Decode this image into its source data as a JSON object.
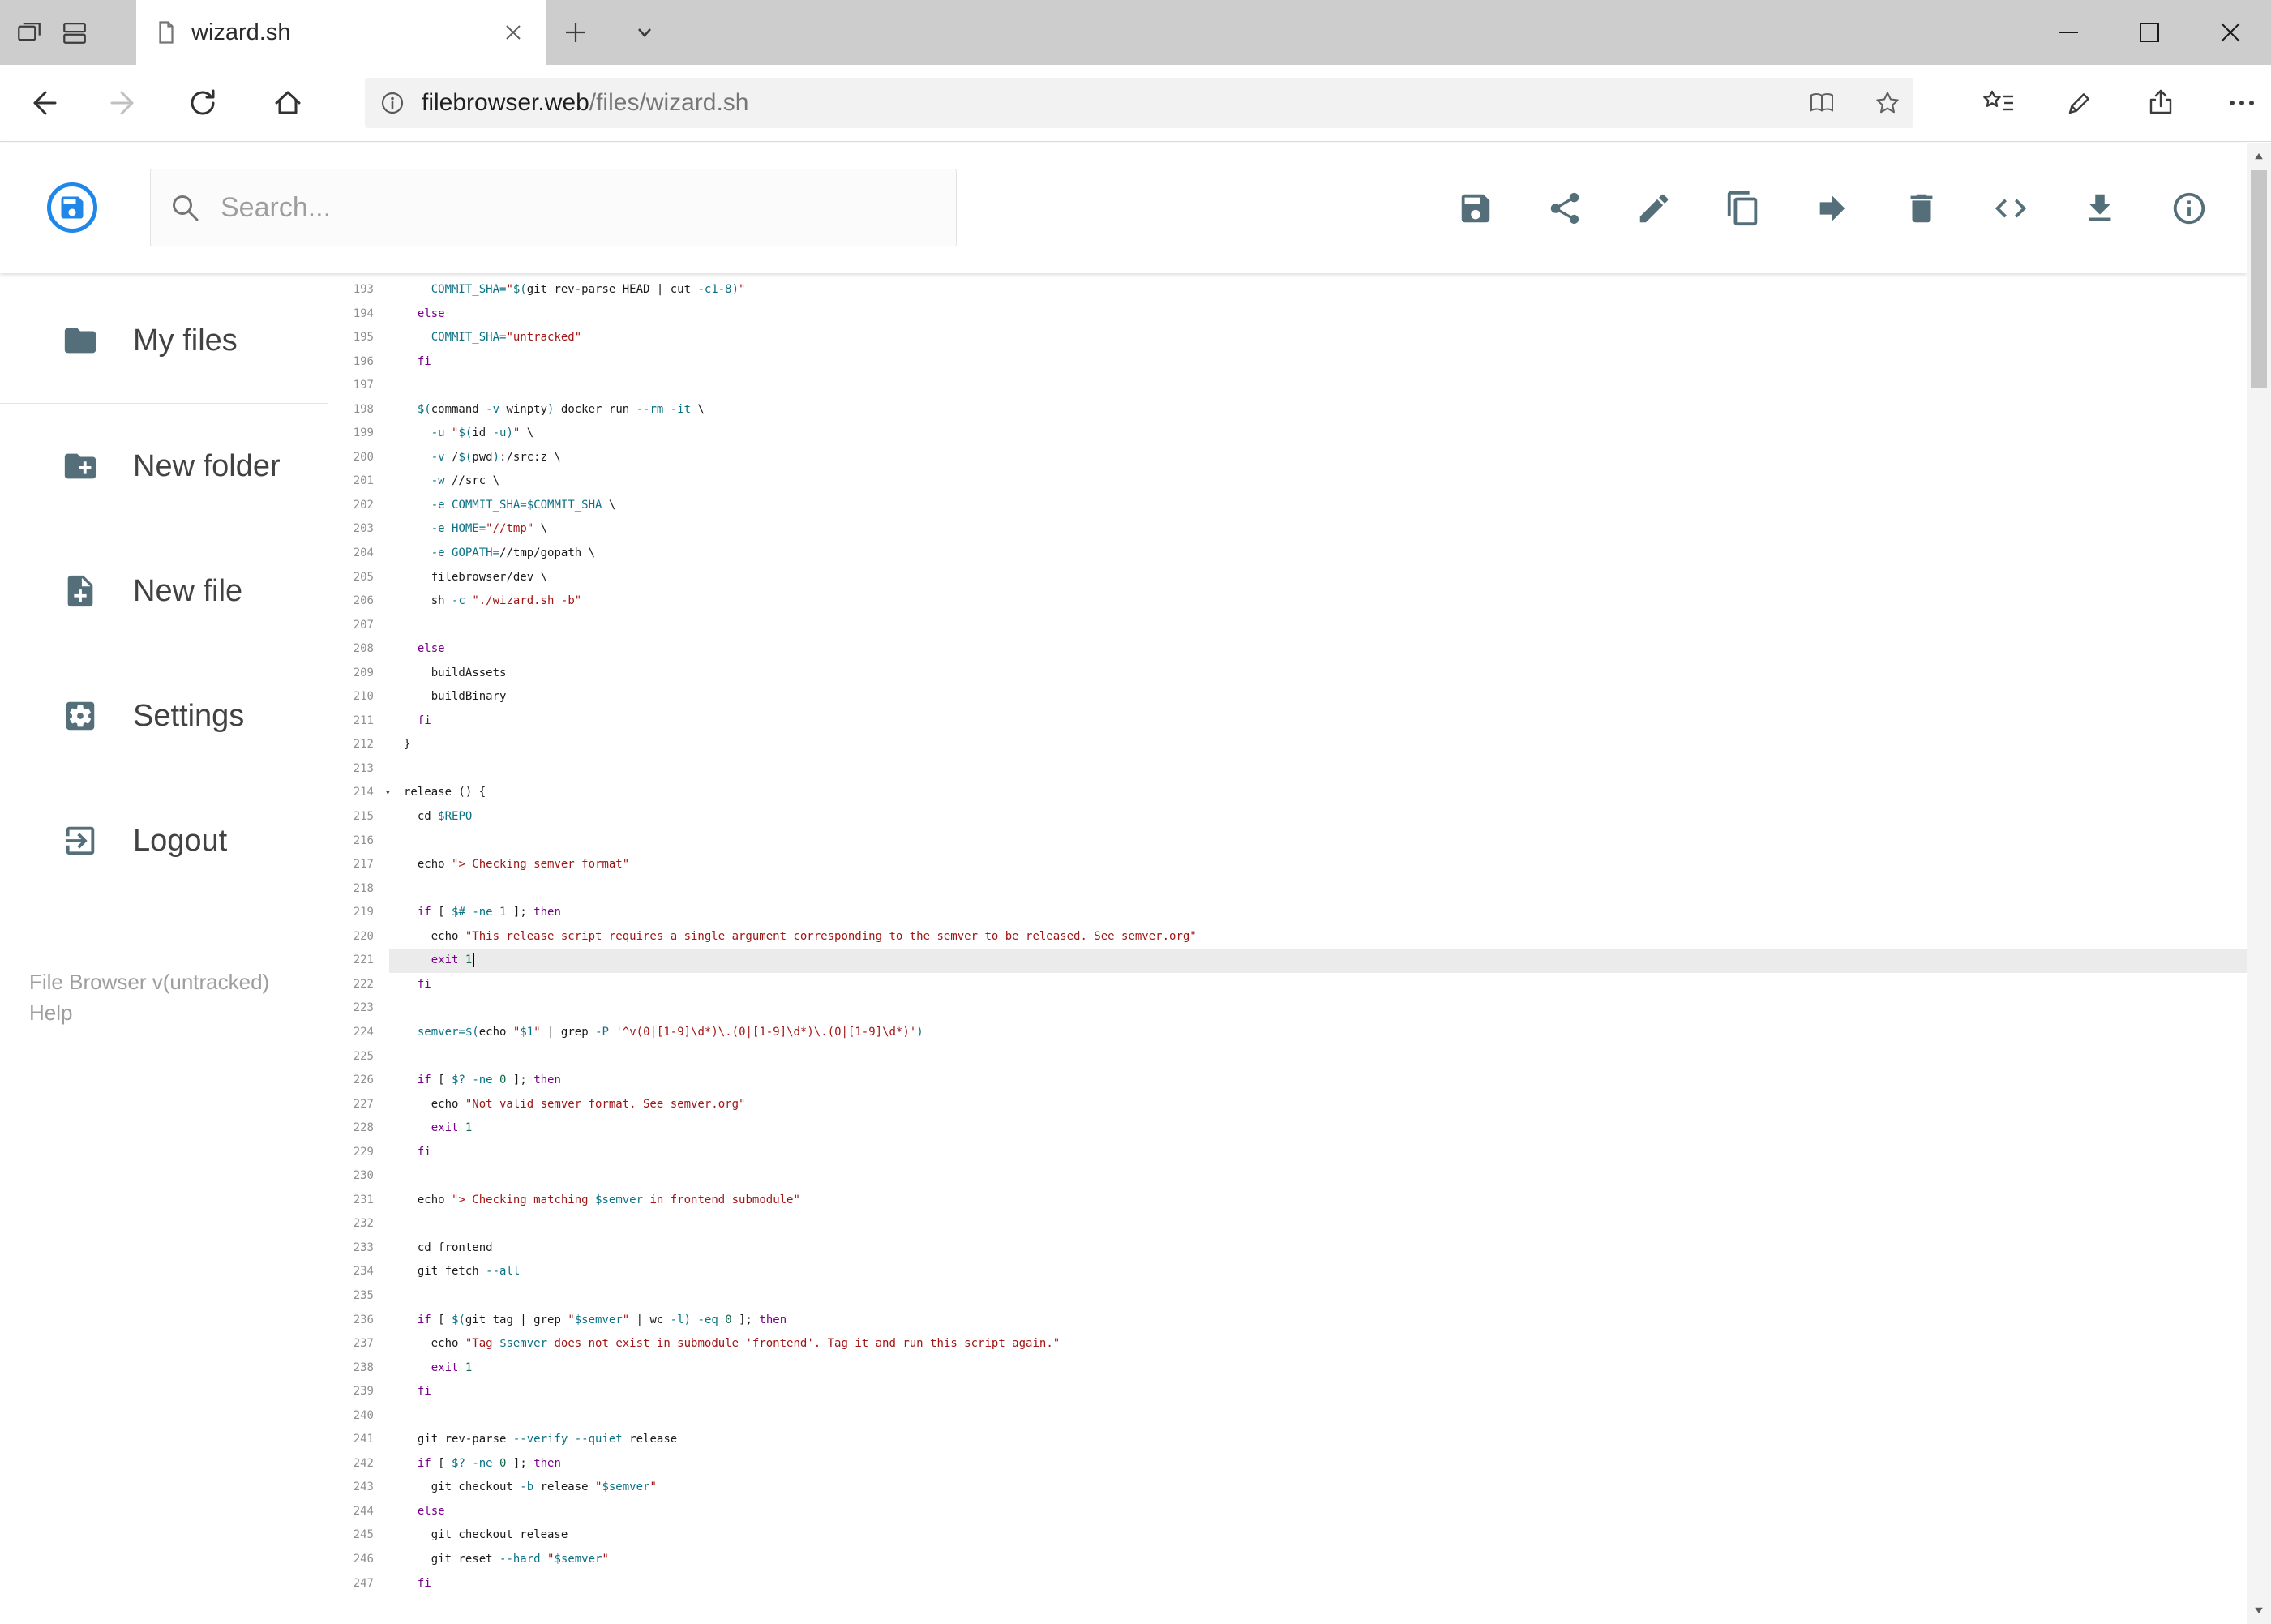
{
  "browser": {
    "tab_title": "wizard.sh",
    "url_domain": "filebrowser.web",
    "url_path": "/files/wizard.sh"
  },
  "header": {
    "search_placeholder": "Search...",
    "toolbar_icons": [
      "save-icon",
      "share-icon",
      "edit-icon",
      "copy-icon",
      "move-icon",
      "delete-icon",
      "code-icon",
      "download-icon",
      "info-icon"
    ],
    "logo_color": "#1f87e8"
  },
  "sidebar": {
    "items": [
      {
        "icon": "folder-icon",
        "label": "My files",
        "divider_after": true
      },
      {
        "icon": "new-folder-icon",
        "label": "New folder"
      },
      {
        "icon": "new-file-icon",
        "label": "New file"
      },
      {
        "icon": "settings-icon",
        "label": "Settings"
      },
      {
        "icon": "logout-icon",
        "label": "Logout"
      }
    ],
    "footer_version": "File Browser v(untracked)",
    "footer_help": "Help"
  },
  "editor": {
    "active_line": 221,
    "fold_line": 214,
    "colors": {
      "p": "#1b1b1b",
      "k": "#770088",
      "s": "#a31515",
      "v": "#0b7285",
      "n": "#116644",
      "gutter": "#8f8f8f",
      "active_bg": "#ebebeb"
    },
    "lines": [
      {
        "n": 193,
        "t": [
          [
            "p",
            "    "
          ],
          [
            "v",
            "COMMIT_SHA="
          ],
          [
            "s",
            "\""
          ],
          [
            "v",
            "$("
          ],
          [
            "p",
            "git rev-parse HEAD | cut "
          ],
          [
            "v",
            "-c1-8"
          ],
          [
            "v",
            ")"
          ],
          [
            "s",
            "\""
          ]
        ]
      },
      {
        "n": 194,
        "t": [
          [
            "p",
            "  "
          ],
          [
            "k",
            "else"
          ]
        ]
      },
      {
        "n": 195,
        "t": [
          [
            "p",
            "    "
          ],
          [
            "v",
            "COMMIT_SHA="
          ],
          [
            "s",
            "\"untracked\""
          ]
        ]
      },
      {
        "n": 196,
        "t": [
          [
            "p",
            "  "
          ],
          [
            "k",
            "fi"
          ]
        ]
      },
      {
        "n": 197,
        "t": []
      },
      {
        "n": 198,
        "t": [
          [
            "p",
            "  "
          ],
          [
            "v",
            "$("
          ],
          [
            "p",
            "command "
          ],
          [
            "v",
            "-v"
          ],
          [
            "p",
            " winpty"
          ],
          [
            "v",
            ")"
          ],
          [
            "p",
            " docker run "
          ],
          [
            "v",
            "--rm"
          ],
          [
            "p",
            " "
          ],
          [
            "v",
            "-it"
          ],
          [
            "p",
            " \\"
          ]
        ]
      },
      {
        "n": 199,
        "t": [
          [
            "p",
            "    "
          ],
          [
            "v",
            "-u"
          ],
          [
            "p",
            " "
          ],
          [
            "s",
            "\""
          ],
          [
            "v",
            "$("
          ],
          [
            "p",
            "id "
          ],
          [
            "v",
            "-u"
          ],
          [
            "v",
            ")"
          ],
          [
            "s",
            "\""
          ],
          [
            "p",
            " \\"
          ]
        ]
      },
      {
        "n": 200,
        "t": [
          [
            "p",
            "    "
          ],
          [
            "v",
            "-v"
          ],
          [
            "p",
            " /"
          ],
          [
            "v",
            "$("
          ],
          [
            "p",
            "pwd"
          ],
          [
            "v",
            ")"
          ],
          [
            "p",
            ":/src:z \\"
          ]
        ]
      },
      {
        "n": 201,
        "t": [
          [
            "p",
            "    "
          ],
          [
            "v",
            "-w"
          ],
          [
            "p",
            " //src \\"
          ]
        ]
      },
      {
        "n": 202,
        "t": [
          [
            "p",
            "    "
          ],
          [
            "v",
            "-e"
          ],
          [
            "p",
            " "
          ],
          [
            "v",
            "COMMIT_SHA="
          ],
          [
            "v",
            "$COMMIT_SHA"
          ],
          [
            "p",
            " \\"
          ]
        ]
      },
      {
        "n": 203,
        "t": [
          [
            "p",
            "    "
          ],
          [
            "v",
            "-e"
          ],
          [
            "p",
            " "
          ],
          [
            "v",
            "HOME="
          ],
          [
            "s",
            "\"//tmp\""
          ],
          [
            "p",
            " \\"
          ]
        ]
      },
      {
        "n": 204,
        "t": [
          [
            "p",
            "    "
          ],
          [
            "v",
            "-e"
          ],
          [
            "p",
            " "
          ],
          [
            "v",
            "GOPATH="
          ],
          [
            "p",
            "//tmp/gopath \\"
          ]
        ]
      },
      {
        "n": 205,
        "t": [
          [
            "p",
            "    filebrowser/dev \\"
          ]
        ]
      },
      {
        "n": 206,
        "t": [
          [
            "p",
            "    sh "
          ],
          [
            "v",
            "-c"
          ],
          [
            "p",
            " "
          ],
          [
            "s",
            "\"./wizard.sh -b\""
          ]
        ]
      },
      {
        "n": 207,
        "t": []
      },
      {
        "n": 208,
        "t": [
          [
            "p",
            "  "
          ],
          [
            "k",
            "else"
          ]
        ]
      },
      {
        "n": 209,
        "t": [
          [
            "p",
            "    buildAssets"
          ]
        ]
      },
      {
        "n": 210,
        "t": [
          [
            "p",
            "    buildBinary"
          ]
        ]
      },
      {
        "n": 211,
        "t": [
          [
            "p",
            "  "
          ],
          [
            "k",
            "fi"
          ]
        ]
      },
      {
        "n": 212,
        "t": [
          [
            "p",
            "}"
          ]
        ]
      },
      {
        "n": 213,
        "t": []
      },
      {
        "n": 214,
        "t": [
          [
            "p",
            "release () {"
          ]
        ]
      },
      {
        "n": 215,
        "t": [
          [
            "p",
            "  cd "
          ],
          [
            "v",
            "$REPO"
          ]
        ]
      },
      {
        "n": 216,
        "t": []
      },
      {
        "n": 217,
        "t": [
          [
            "p",
            "  echo "
          ],
          [
            "s",
            "\"> Checking semver format\""
          ]
        ]
      },
      {
        "n": 218,
        "t": []
      },
      {
        "n": 219,
        "t": [
          [
            "p",
            "  "
          ],
          [
            "k",
            "if"
          ],
          [
            "p",
            " [ "
          ],
          [
            "v",
            "$#"
          ],
          [
            "p",
            " "
          ],
          [
            "v",
            "-ne"
          ],
          [
            "p",
            " "
          ],
          [
            "n",
            "1"
          ],
          [
            "p",
            " ]; "
          ],
          [
            "k",
            "then"
          ]
        ]
      },
      {
        "n": 220,
        "t": [
          [
            "p",
            "    echo "
          ],
          [
            "s",
            "\"This release script requires a single argument corresponding to the semver to be released. See semver.org\""
          ]
        ]
      },
      {
        "n": 221,
        "t": [
          [
            "p",
            "    "
          ],
          [
            "k",
            "exit"
          ],
          [
            "p",
            " "
          ],
          [
            "n",
            "1"
          ]
        ]
      },
      {
        "n": 222,
        "t": [
          [
            "p",
            "  "
          ],
          [
            "k",
            "fi"
          ]
        ]
      },
      {
        "n": 223,
        "t": []
      },
      {
        "n": 224,
        "t": [
          [
            "p",
            "  "
          ],
          [
            "v",
            "semver="
          ],
          [
            "v",
            "$("
          ],
          [
            "p",
            "echo "
          ],
          [
            "s",
            "\""
          ],
          [
            "v",
            "$1"
          ],
          [
            "s",
            "\""
          ],
          [
            "p",
            " | grep "
          ],
          [
            "v",
            "-P"
          ],
          [
            "p",
            " "
          ],
          [
            "s",
            "'^v(0|[1-9]\\d*)\\.(0|[1-9]\\d*)\\.(0|[1-9]\\d*)'"
          ],
          [
            "v",
            ")"
          ]
        ]
      },
      {
        "n": 225,
        "t": []
      },
      {
        "n": 226,
        "t": [
          [
            "p",
            "  "
          ],
          [
            "k",
            "if"
          ],
          [
            "p",
            " [ "
          ],
          [
            "v",
            "$?"
          ],
          [
            "p",
            " "
          ],
          [
            "v",
            "-ne"
          ],
          [
            "p",
            " "
          ],
          [
            "n",
            "0"
          ],
          [
            "p",
            " ]; "
          ],
          [
            "k",
            "then"
          ]
        ]
      },
      {
        "n": 227,
        "t": [
          [
            "p",
            "    echo "
          ],
          [
            "s",
            "\"Not valid semver format. See semver.org\""
          ]
        ]
      },
      {
        "n": 228,
        "t": [
          [
            "p",
            "    "
          ],
          [
            "k",
            "exit"
          ],
          [
            "p",
            " "
          ],
          [
            "n",
            "1"
          ]
        ]
      },
      {
        "n": 229,
        "t": [
          [
            "p",
            "  "
          ],
          [
            "k",
            "fi"
          ]
        ]
      },
      {
        "n": 230,
        "t": []
      },
      {
        "n": 231,
        "t": [
          [
            "p",
            "  echo "
          ],
          [
            "s",
            "\"> Checking matching "
          ],
          [
            "v",
            "$semver"
          ],
          [
            "s",
            " in frontend submodule\""
          ]
        ]
      },
      {
        "n": 232,
        "t": []
      },
      {
        "n": 233,
        "t": [
          [
            "p",
            "  cd frontend"
          ]
        ]
      },
      {
        "n": 234,
        "t": [
          [
            "p",
            "  git fetch "
          ],
          [
            "v",
            "--all"
          ]
        ]
      },
      {
        "n": 235,
        "t": []
      },
      {
        "n": 236,
        "t": [
          [
            "p",
            "  "
          ],
          [
            "k",
            "if"
          ],
          [
            "p",
            " [ "
          ],
          [
            "v",
            "$("
          ],
          [
            "p",
            "git tag | grep "
          ],
          [
            "s",
            "\""
          ],
          [
            "v",
            "$semver"
          ],
          [
            "s",
            "\""
          ],
          [
            "p",
            " | wc "
          ],
          [
            "v",
            "-l"
          ],
          [
            "v",
            ")"
          ],
          [
            "p",
            " "
          ],
          [
            "v",
            "-eq"
          ],
          [
            "p",
            " "
          ],
          [
            "n",
            "0"
          ],
          [
            "p",
            " ]; "
          ],
          [
            "k",
            "then"
          ]
        ]
      },
      {
        "n": 237,
        "t": [
          [
            "p",
            "    echo "
          ],
          [
            "s",
            "\"Tag "
          ],
          [
            "v",
            "$semver"
          ],
          [
            "s",
            " does not exist in submodule 'frontend'. Tag it and run this script again.\""
          ]
        ]
      },
      {
        "n": 238,
        "t": [
          [
            "p",
            "    "
          ],
          [
            "k",
            "exit"
          ],
          [
            "p",
            " "
          ],
          [
            "n",
            "1"
          ]
        ]
      },
      {
        "n": 239,
        "t": [
          [
            "p",
            "  "
          ],
          [
            "k",
            "fi"
          ]
        ]
      },
      {
        "n": 240,
        "t": []
      },
      {
        "n": 241,
        "t": [
          [
            "p",
            "  git rev-parse "
          ],
          [
            "v",
            "--verify"
          ],
          [
            "p",
            " "
          ],
          [
            "v",
            "--quiet"
          ],
          [
            "p",
            " release"
          ]
        ]
      },
      {
        "n": 242,
        "t": [
          [
            "p",
            "  "
          ],
          [
            "k",
            "if"
          ],
          [
            "p",
            " [ "
          ],
          [
            "v",
            "$?"
          ],
          [
            "p",
            " "
          ],
          [
            "v",
            "-ne"
          ],
          [
            "p",
            " "
          ],
          [
            "n",
            "0"
          ],
          [
            "p",
            " ]; "
          ],
          [
            "k",
            "then"
          ]
        ]
      },
      {
        "n": 243,
        "t": [
          [
            "p",
            "    git checkout "
          ],
          [
            "v",
            "-b"
          ],
          [
            "p",
            " release "
          ],
          [
            "s",
            "\""
          ],
          [
            "v",
            "$semver"
          ],
          [
            "s",
            "\""
          ]
        ]
      },
      {
        "n": 244,
        "t": [
          [
            "p",
            "  "
          ],
          [
            "k",
            "else"
          ]
        ]
      },
      {
        "n": 245,
        "t": [
          [
            "p",
            "    git checkout release"
          ]
        ]
      },
      {
        "n": 246,
        "t": [
          [
            "p",
            "    git reset "
          ],
          [
            "v",
            "--hard"
          ],
          [
            "p",
            " "
          ],
          [
            "s",
            "\""
          ],
          [
            "v",
            "$semver"
          ],
          [
            "s",
            "\""
          ]
        ]
      },
      {
        "n": 247,
        "t": [
          [
            "p",
            "  "
          ],
          [
            "k",
            "fi"
          ]
        ]
      }
    ]
  }
}
